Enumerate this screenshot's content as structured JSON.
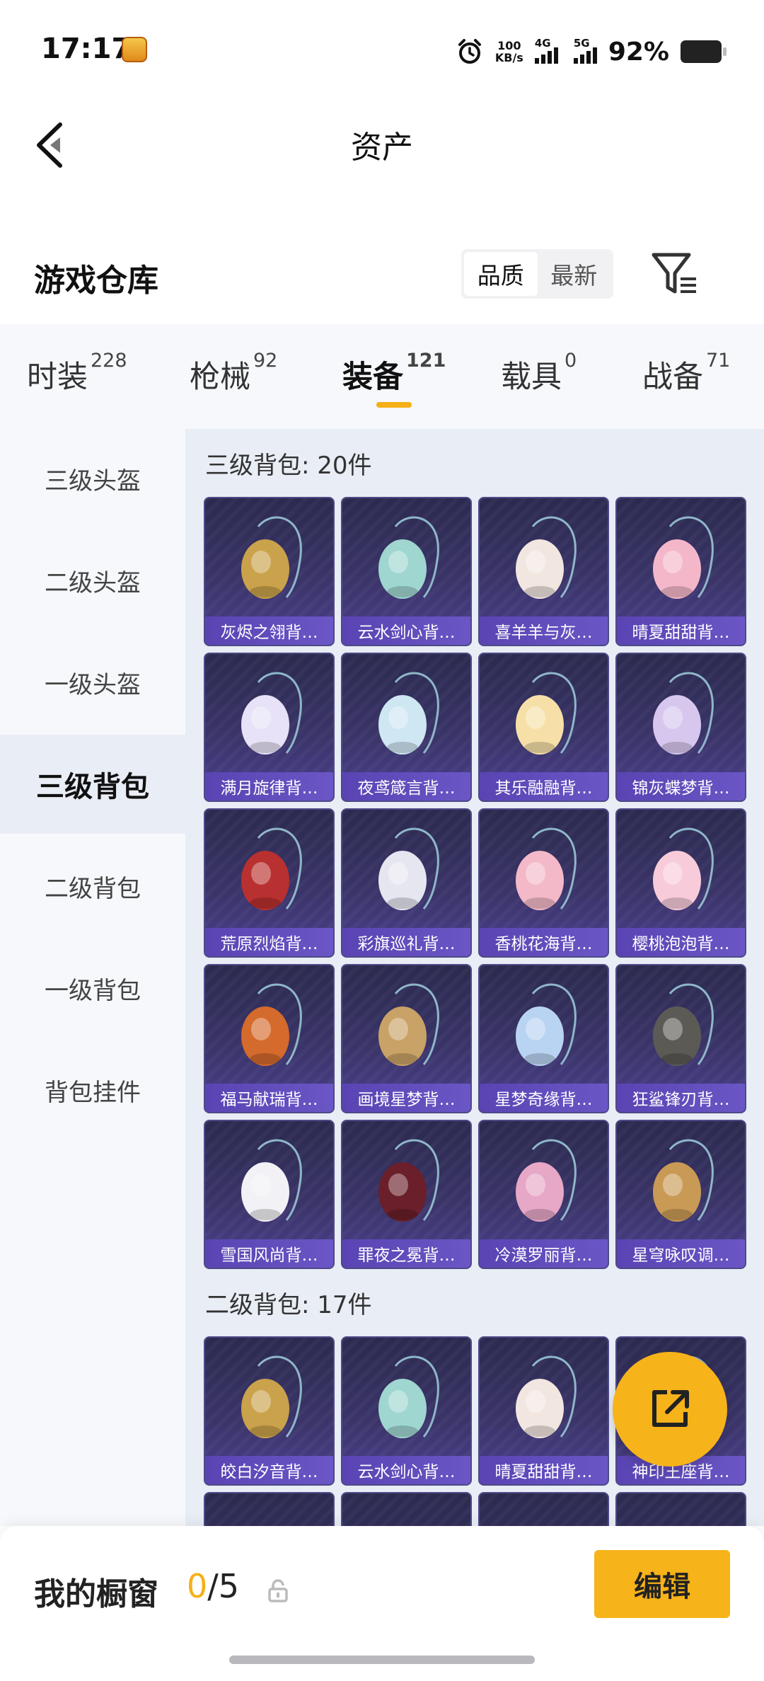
{
  "status_bar": {
    "time": "17:17",
    "net_speed_value": "100",
    "net_speed_unit": "KB/s",
    "sim1_label": "4G",
    "sim2_label": "5G",
    "battery": "92%",
    "icons": [
      "app-icon",
      "alarm-icon",
      "signal-icon",
      "battery-icon"
    ]
  },
  "header": {
    "title": "资产",
    "back_icon": "chevron-left-icon"
  },
  "warehouse": {
    "title": "游戏仓库",
    "sort_options": [
      "品质",
      "最新"
    ],
    "sort_selected": "品质",
    "filter_icon": "filter-icon"
  },
  "tabs": [
    {
      "label": "时装",
      "count": "228"
    },
    {
      "label": "枪械",
      "count": "92"
    },
    {
      "label": "装备",
      "count": "121",
      "active": true
    },
    {
      "label": "载具",
      "count": "0"
    },
    {
      "label": "战备",
      "count": "71"
    }
  ],
  "sidebar": {
    "items": [
      "三级头盔",
      "二级头盔",
      "一级头盔",
      "三级背包",
      "二级背包",
      "一级背包",
      "背包挂件"
    ],
    "active": "三级背包"
  },
  "groups": [
    {
      "title": "三级背包: 20件",
      "items": [
        "灰烬之翎背…",
        "云水剑心背…",
        "喜羊羊与灰…",
        "晴夏甜甜背…",
        "满月旋律背…",
        "夜鸢箴言背…",
        "其乐融融背…",
        "锦灰蝶梦背…",
        "荒原烈焰背…",
        "彩旗巡礼背…",
        "香桃花海背…",
        "樱桃泡泡背…",
        "福马献瑞背…",
        "画境星梦背…",
        "星梦奇缘背…",
        "狂鲨锋刃背…",
        "雪国风尚背…",
        "罪夜之冕背…",
        "冷漠罗丽背…",
        "星穹咏叹调…"
      ]
    },
    {
      "title": "二级背包: 17件",
      "items": [
        "皎白汐音背…",
        "云水剑心背…",
        "晴夏甜甜背…",
        "神印王座背…"
      ]
    }
  ],
  "fab": {
    "icon": "share-icon"
  },
  "bottom_bar": {
    "label": "我的橱窗",
    "count_current": "0",
    "count_total": "/5",
    "lock_icon": "lock-icon",
    "edit_label": "编辑"
  },
  "colors": {
    "accent": "#f7b31a",
    "card_bg": "#3a3468",
    "card_label": "#5a44b3",
    "panel_bg": "#e9edf5",
    "sidebar_bg": "#f6f8fc"
  }
}
